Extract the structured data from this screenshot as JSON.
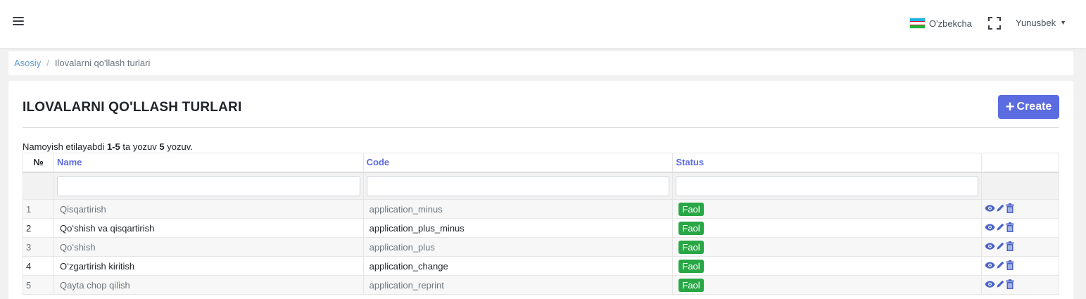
{
  "topbar": {
    "language": "O'zbekcha",
    "user": "Yunusbek"
  },
  "breadcrumb": {
    "home": "Asosiy",
    "current": "Ilovalarni qo'llash turlari"
  },
  "page": {
    "title": "ILOVALARNI QO'LLASH TURLARI",
    "create_label": "Create",
    "summary_prefix": "Namoyish etilayabdi ",
    "summary_range": "1-5",
    "summary_mid": " ta yozuv ",
    "summary_count": "5",
    "summary_suffix": " yozuv."
  },
  "table": {
    "headers": {
      "num": "№",
      "name": "Name",
      "code": "Code",
      "status": "Status"
    },
    "rows": [
      {
        "num": "1",
        "name": "Qisqartirish",
        "code": "application_minus",
        "status": "Faol"
      },
      {
        "num": "2",
        "name": "Qo‘shish va qisqartirish",
        "code": "application_plus_minus",
        "status": "Faol"
      },
      {
        "num": "3",
        "name": "Qo‘shish",
        "code": "application_plus",
        "status": "Faol"
      },
      {
        "num": "4",
        "name": "O‘zgartirish kiritish",
        "code": "application_change",
        "status": "Faol"
      },
      {
        "num": "5",
        "name": "Qayta chop qilish",
        "code": "application_reprint",
        "status": "Faol"
      }
    ]
  },
  "colors": {
    "accent": "#5b6be0",
    "status_active": "#28a745",
    "link": "#5b9bd5"
  }
}
